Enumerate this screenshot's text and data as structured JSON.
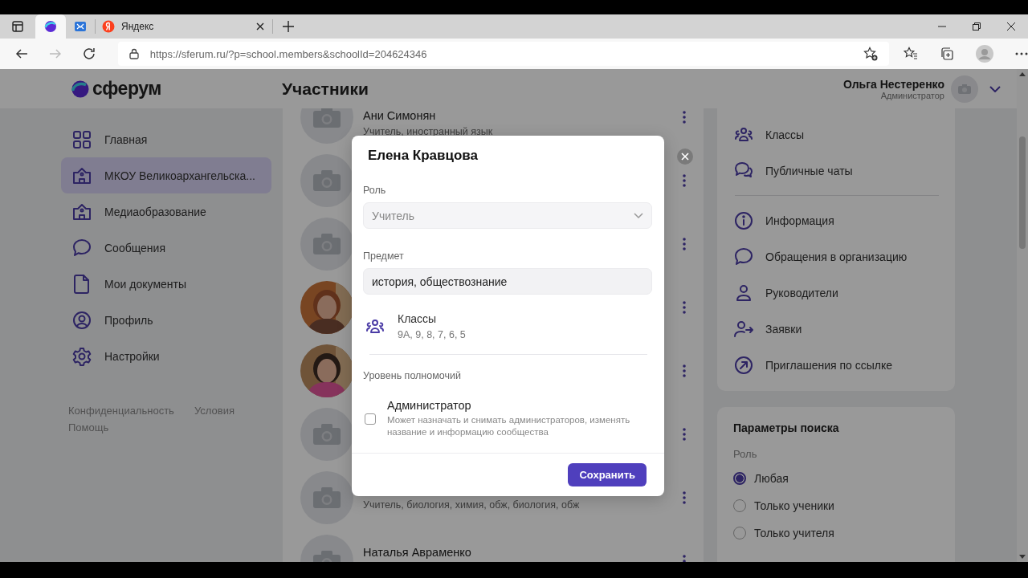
{
  "browser": {
    "tabs": [
      {
        "kind": "sferum",
        "selected": true
      },
      {
        "kind": "mail",
        "selected": false
      },
      {
        "kind": "yandex",
        "title": "Яндекс",
        "selected": false
      }
    ],
    "url": "https://sferum.ru/?p=school.members&schoolId=204624346"
  },
  "header": {
    "logo": "сферум",
    "title": "Участники",
    "user": {
      "name": "Ольга Нестеренко",
      "role": "Администратор"
    }
  },
  "sidebar": {
    "items": [
      {
        "label": "Главная",
        "selected": false
      },
      {
        "label": "МКОУ Великоархангельска...",
        "selected": true
      },
      {
        "label": "Медиаобразование",
        "selected": false
      },
      {
        "label": "Сообщения",
        "selected": false
      },
      {
        "label": "Мои документы",
        "selected": false
      },
      {
        "label": "Профиль",
        "selected": false
      },
      {
        "label": "Настройки",
        "selected": false
      }
    ],
    "footer_links": [
      "Конфиденциальность",
      "Условия",
      "Помощь"
    ]
  },
  "members": [
    {
      "has_photo": false,
      "name": "Ани Симонян",
      "subtitle": "Учитель, иностранный язык"
    },
    {
      "has_photo": false
    },
    {
      "has_photo": false
    },
    {
      "has_photo": true
    },
    {
      "has_photo": true
    },
    {
      "has_photo": false
    },
    {
      "has_photo": false,
      "subtitle": "Учитель, биология, химия, обж, биология, обж"
    },
    {
      "has_photo": false,
      "name": "Наталья Авраменко"
    }
  ],
  "right_panel": {
    "groups": [
      [
        "Классы",
        "Публичные чаты"
      ],
      [
        "Информация",
        "Обращения в организацию",
        "Руководители",
        "Заявки",
        "Приглашения по ссылке"
      ]
    ],
    "search_params": {
      "title": "Параметры поиска",
      "label": "Роль",
      "options": [
        {
          "label": "Любая",
          "selected": true
        },
        {
          "label": "Только ученики",
          "selected": false
        },
        {
          "label": "Только учителя",
          "selected": false
        }
      ]
    }
  },
  "modal": {
    "title": "Елена Кравцова",
    "role": {
      "label": "Роль",
      "value": "Учитель",
      "disabled": true
    },
    "subject": {
      "label": "Предмет",
      "value": "история, обществознание"
    },
    "classes": {
      "title": "Классы",
      "value": "9А, 9, 8, 7, 6, 5"
    },
    "permissions": {
      "label": "Уровень полномочий",
      "option": {
        "title": "Администратор",
        "description": "Может назначать и снимать администраторов, изменять название и информацию сообщества",
        "checked": false
      }
    },
    "save_button": "Сохранить"
  }
}
